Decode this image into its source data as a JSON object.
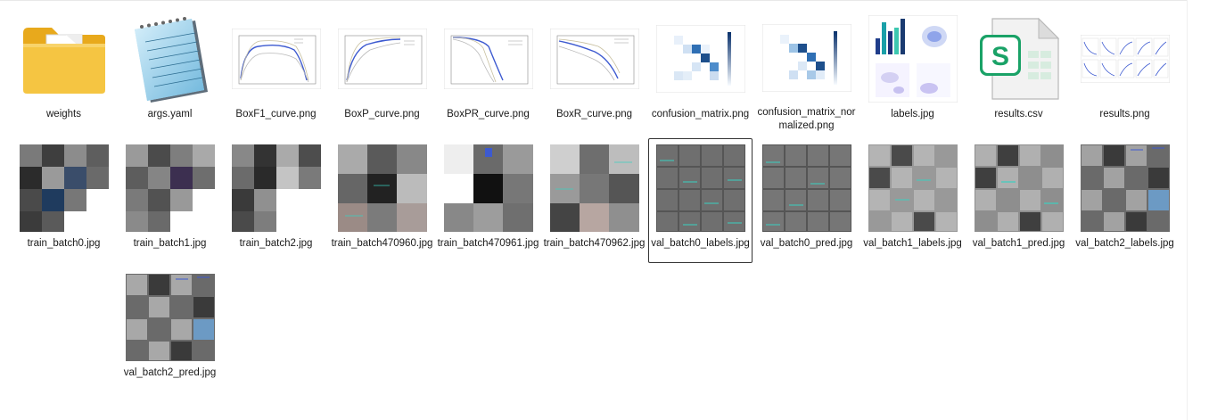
{
  "colors": {
    "folder": "#f5c542",
    "selection_border": "#333333",
    "csv_accent": "#1aa267",
    "chart_blue": "#3d5ad0",
    "matrix_blue": "#2f6fb4"
  },
  "files": [
    {
      "name": "weights",
      "icon": "folder-icon"
    },
    {
      "name": "args.yaml",
      "icon": "notepad-icon"
    },
    {
      "name": "BoxF1_curve.png",
      "icon": "curve-plot-icon"
    },
    {
      "name": "BoxP_curve.png",
      "icon": "curve-plot-icon"
    },
    {
      "name": "BoxPR_curve.png",
      "icon": "curve-plot-icon"
    },
    {
      "name": "BoxR_curve.png",
      "icon": "curve-plot-icon"
    },
    {
      "name": "confusion_matrix.png",
      "icon": "confusion-matrix-icon"
    },
    {
      "name": "confusion_matrix_normalized.png",
      "icon": "confusion-matrix-icon"
    },
    {
      "name": "labels.jpg",
      "icon": "labels-plot-icon"
    },
    {
      "name": "results.csv",
      "icon": "spreadsheet-icon"
    },
    {
      "name": "results.png",
      "icon": "results-plot-icon"
    },
    {
      "name": "train_batch0.jpg",
      "icon": "image-mosaic-icon"
    },
    {
      "name": "train_batch1.jpg",
      "icon": "image-mosaic-icon"
    },
    {
      "name": "train_batch2.jpg",
      "icon": "image-mosaic-icon"
    },
    {
      "name": "train_batch470960.jpg",
      "icon": "image-mosaic-icon"
    },
    {
      "name": "train_batch470961.jpg",
      "icon": "image-mosaic-icon"
    },
    {
      "name": "train_batch470962.jpg",
      "icon": "image-mosaic-icon"
    },
    {
      "name": "val_batch0_labels.jpg",
      "icon": "image-mosaic-icon",
      "selected": true
    },
    {
      "name": "val_batch0_pred.jpg",
      "icon": "image-mosaic-icon"
    },
    {
      "name": "val_batch1_labels.jpg",
      "icon": "image-mosaic-icon"
    },
    {
      "name": "val_batch1_pred.jpg",
      "icon": "image-mosaic-icon"
    },
    {
      "name": "val_batch2_labels.jpg",
      "icon": "image-mosaic-icon"
    },
    {
      "name": "val_batch2_pred.jpg",
      "icon": "image-mosaic-icon"
    }
  ]
}
